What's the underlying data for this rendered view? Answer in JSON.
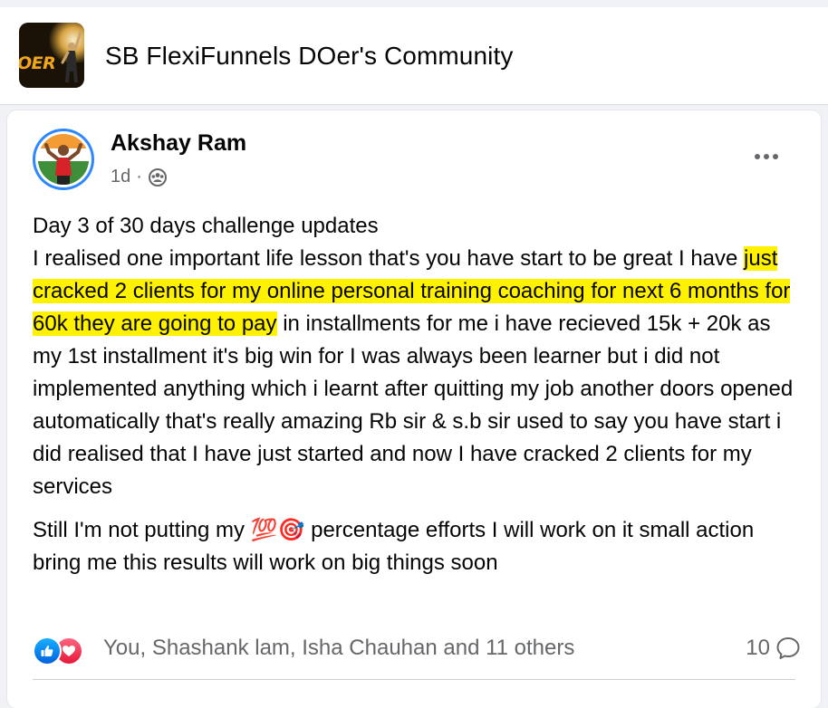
{
  "group": {
    "title": "SB FlexiFunnels DOer's Community",
    "logo_text": "OER"
  },
  "post": {
    "author": "Akshay Ram",
    "time": "1d",
    "separator": "·",
    "audience_icon": "group-audience-icon",
    "more_icon": "more-options-icon",
    "paragraph1": {
      "line1": "Day 3 of 30 days challenge updates",
      "before_highlight": "I realised one important life lesson that's you have start to be great I have ",
      "highlight": "just cracked 2 clients for my online personal training coaching for next 6 months for 60k they are going to pay",
      "after_highlight": " in installments for me i have recieved 15k + 20k as my 1st installment it's big win for I was always been learner but i did not implemented anything which i learnt after quitting my job another doors opened automatically that's really amazing Rb sir & s.b sir used to say you have start i did realised that I have just started and now I have cracked 2 clients for my services"
    },
    "paragraph2": {
      "before_emoji": "Still I'm not putting my ",
      "emoji": "💯🎯",
      "after_emoji": " percentage efforts I will work on it small action bring me this results will work on big things soon"
    },
    "reactions": {
      "icons": [
        "like-icon",
        "love-icon"
      ],
      "names": "You, Shashank lam, Isha Chauhan and 11 others",
      "comment_count": "10"
    }
  },
  "colors": {
    "highlight": "#fff200",
    "like_blue": "#0866ff",
    "love_red": "#f33e58",
    "secondary_text": "#65676b"
  }
}
